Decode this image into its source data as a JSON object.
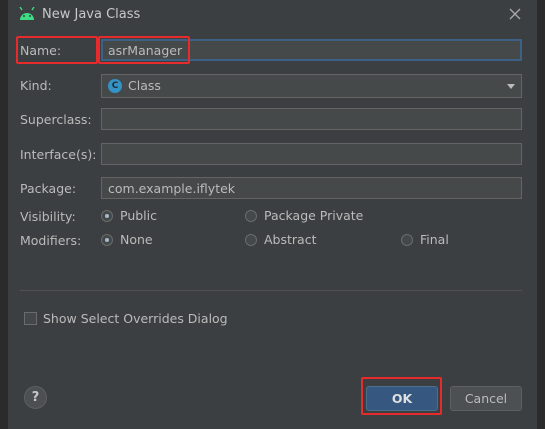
{
  "dialog": {
    "title": "New Java Class",
    "icon": "android-icon",
    "close_icon": "close-icon"
  },
  "fields": {
    "name": {
      "label": "Name:",
      "value": "asrManager"
    },
    "kind": {
      "label": "Kind:",
      "value": "Class",
      "icon": "class-icon",
      "icon_letter": "C"
    },
    "superclass": {
      "label": "Superclass:",
      "value": ""
    },
    "interfaces": {
      "label": "Interface(s):",
      "value": ""
    },
    "package": {
      "label": "Package:",
      "value": "com.example.iflytek"
    }
  },
  "visibility": {
    "label": "Visibility:",
    "options": [
      {
        "label": "Public",
        "selected": true
      },
      {
        "label": "Package Private",
        "selected": false
      }
    ]
  },
  "modifiers": {
    "label": "Modifiers:",
    "options": [
      {
        "label": "None",
        "selected": true
      },
      {
        "label": "Abstract",
        "selected": false
      },
      {
        "label": "Final",
        "selected": false
      }
    ]
  },
  "overrides_checkbox": {
    "label": "Show Select Overrides Dialog",
    "checked": false
  },
  "buttons": {
    "help": "?",
    "ok": "OK",
    "cancel": "Cancel"
  },
  "colors": {
    "accent": "#365880",
    "highlight": "#e52b2b",
    "background": "#3c3f41"
  }
}
